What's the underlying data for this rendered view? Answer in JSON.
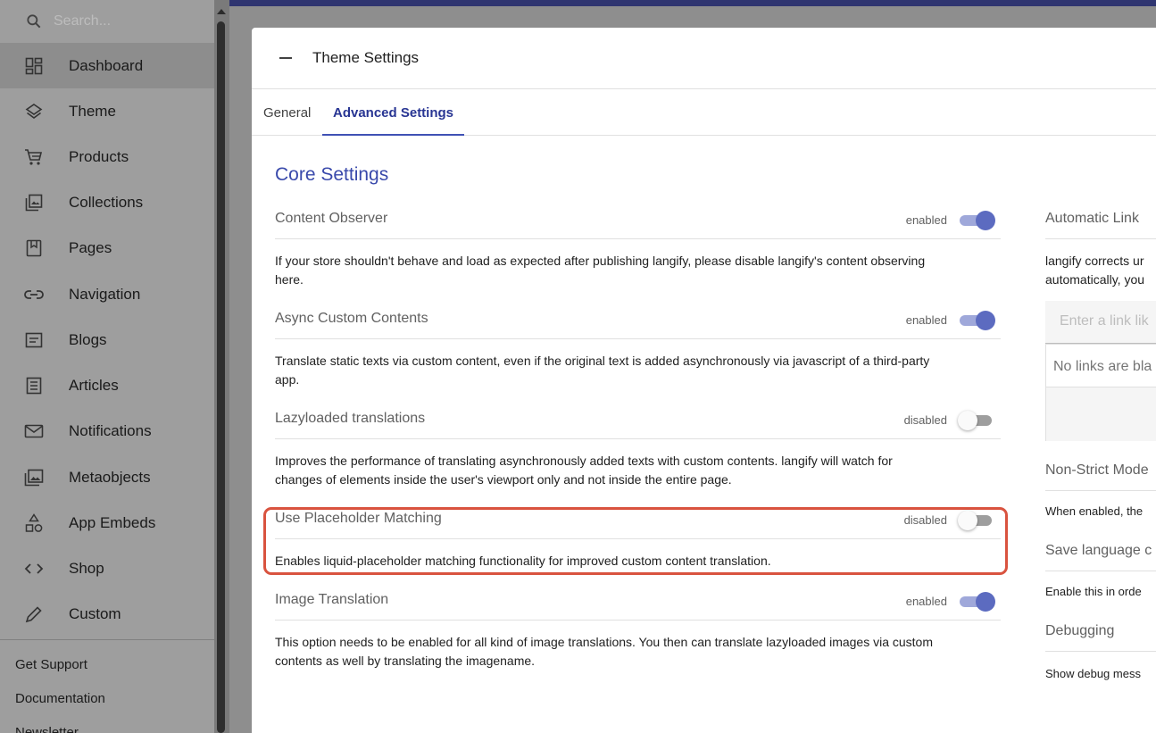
{
  "sidebar": {
    "search_placeholder": "Search...",
    "items": [
      {
        "label": "Dashboard",
        "icon": "dashboard-icon",
        "active": true
      },
      {
        "label": "Theme",
        "icon": "layers-icon"
      },
      {
        "label": "Products",
        "icon": "cart-icon"
      },
      {
        "label": "Collections",
        "icon": "collections-icon"
      },
      {
        "label": "Pages",
        "icon": "page-icon"
      },
      {
        "label": "Navigation",
        "icon": "link-icon"
      },
      {
        "label": "Blogs",
        "icon": "blog-icon"
      },
      {
        "label": "Articles",
        "icon": "article-icon"
      },
      {
        "label": "Notifications",
        "icon": "mail-icon"
      },
      {
        "label": "Metaobjects",
        "icon": "metaobjects-icon"
      },
      {
        "label": "App Embeds",
        "icon": "shapes-icon"
      },
      {
        "label": "Shop",
        "icon": "code-icon"
      },
      {
        "label": "Custom",
        "icon": "pencil-icon"
      }
    ],
    "links": [
      "Get Support",
      "Documentation",
      "Newsletter"
    ]
  },
  "panel": {
    "title": "Theme Settings",
    "tabs": [
      "General",
      "Advanced Settings"
    ],
    "active_tab": "Advanced Settings",
    "section_title": "Core Settings",
    "settings": [
      {
        "label": "Content Observer",
        "state": "enabled",
        "on": true,
        "description_lines": [
          "If your store shouldn't behave and load as expected after publishing langify, please disable langify's content observing",
          "here."
        ]
      },
      {
        "label": "Async Custom Contents",
        "state": "enabled",
        "on": true,
        "description_lines": [
          "Translate static texts via custom content, even if the original text is added asynchronously via javascript of a third-party",
          "app."
        ]
      },
      {
        "label": "Lazyloaded translations",
        "state": "disabled",
        "on": false,
        "description_lines": [
          "Improves the performance of translating asynchronously added texts with custom contents. langify will watch for",
          "changes of elements inside the user's viewport only and not inside the entire page."
        ]
      },
      {
        "label": "Use Placeholder Matching",
        "state": "disabled",
        "on": false,
        "description_lines": [
          "Enables liquid-placeholder matching functionality for improved custom content translation."
        ]
      },
      {
        "label": "Image Translation",
        "state": "enabled",
        "on": true,
        "description_lines": [
          "This option needs to be enabled for all kind of image translations. You then can translate lazyloaded images via custom",
          "contents as well by translating the imagename."
        ]
      }
    ],
    "right_column": {
      "auto_link_label": "Automatic Link",
      "auto_link_text_1": "langify corrects ur",
      "auto_link_text_2": "automatically, you",
      "input_placeholder": "Enter a link lik",
      "no_links": "No links are bla",
      "non_strict_label": "Non-Strict Mode",
      "non_strict_text": "When enabled, the",
      "save_language_label": "Save language c",
      "save_language_text": "Enable this in orde",
      "debugging_label": "Debugging",
      "debugging_text": "Show debug mess"
    }
  },
  "colors": {
    "accent": "#3f51b5",
    "toggle_on": "#5c6bc0",
    "highlight": "#d9533f",
    "topbar": "#2f3570"
  }
}
